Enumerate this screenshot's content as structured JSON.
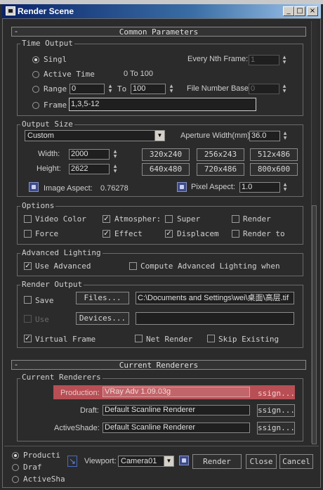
{
  "window": {
    "title": "Render Scene",
    "minimize": "_",
    "maximize": "□",
    "close": "×"
  },
  "common": {
    "header": "Common Parameters",
    "time_output": {
      "label": "Time Output",
      "single": "Singl",
      "every_nth_label": "Every Nth Frame:",
      "every_nth_value": "1",
      "active_time": "Active Time",
      "active_range": "0 To 100",
      "range": "Range",
      "range_from": "0",
      "range_to_label": "To",
      "range_to": "100",
      "file_number_base_label": "File Number Base:",
      "file_number_base": "0",
      "frame": "Frame",
      "frame_value": "1,3,5-12"
    },
    "output_size": {
      "label": "Output Size",
      "preset": "Custom",
      "aperture_label": "Aperture Width(mm):",
      "aperture_value": "36.0",
      "width_label": "Width:",
      "width_value": "2000",
      "height_label": "Height:",
      "height_value": "2622",
      "presets": [
        "320x240",
        "256x243",
        "512x486",
        "640x480",
        "720x486",
        "800x600"
      ],
      "image_aspect_label": "Image Aspect:",
      "image_aspect_value": "0.76278",
      "pixel_aspect_label": "Pixel Aspect:",
      "pixel_aspect_value": "1.0"
    },
    "options": {
      "label": "Options",
      "video_color": "Video Color",
      "atmospheric": "Atmospher:",
      "super_black": "Super",
      "render_hidden": "Render",
      "force": "Force",
      "effects": "Effect",
      "displacement": "Displacem",
      "render_to": "Render to"
    },
    "advanced_lighting": {
      "label": "Advanced Lighting",
      "use_advanced": "Use Advanced",
      "compute": "Compute Advanced Lighting when"
    },
    "render_output": {
      "label": "Render Output",
      "save": "Save",
      "files_btn": "Files...",
      "path": "C:\\Documents and Settings\\wei\\桌面\\高层.tif",
      "use": "Use",
      "devices_btn": "Devices...",
      "virtual_frame": "Virtual Frame",
      "net_render": "Net Render",
      "skip_existing": "Skip Existing"
    }
  },
  "current_renderers": {
    "header": "Current Renderers",
    "group_label": "Current Renderers",
    "production_label": "Production:",
    "production_value": "VRay Adv 1.09.03g",
    "production_btn": "ssign...",
    "draft_label": "Draft:",
    "draft_value": "Default Scanline Renderer",
    "draft_btn": "ssign...",
    "activeshade_label": "ActiveShade:",
    "activeshade_value": "Default Scanline Renderer",
    "activeshade_btn": "ssign..."
  },
  "bottom": {
    "production": "Producti",
    "draft": "Draf",
    "activeshade": "ActiveSha",
    "viewport_label": "Viewport:",
    "viewport_value": "Camera01",
    "render_btn": "Render",
    "close_btn": "Close",
    "cancel_btn": "Cancel"
  },
  "colors": {
    "title_start": "#0a246a",
    "title_end": "#a6caf0",
    "production_highlight": "#b84f55",
    "panel_bg": "#2b2b2b"
  }
}
